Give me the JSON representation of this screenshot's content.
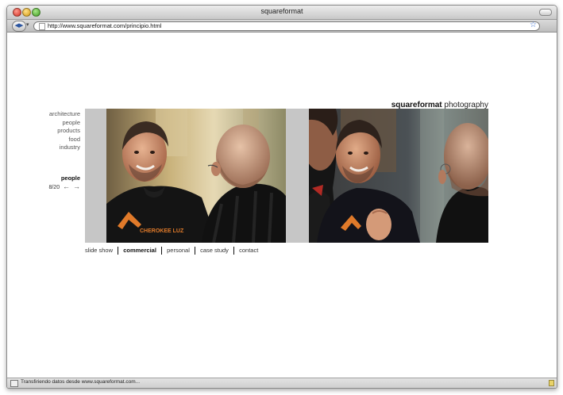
{
  "window": {
    "title": "squareformat"
  },
  "toolbar": {
    "url": "http://www.squareformat.com/principio.html",
    "back_icon": "back-arrow-icon",
    "bookmark_icon": "star-icon"
  },
  "site": {
    "brand_bold": "squareformat",
    "brand_light": "photography",
    "categories": [
      {
        "label": "architecture"
      },
      {
        "label": "people"
      },
      {
        "label": "products"
      },
      {
        "label": "food"
      },
      {
        "label": "industry"
      }
    ],
    "section_title": "people",
    "pager": "8/20",
    "prev_icon": "arrow-left-icon",
    "next_icon": "arrow-right-icon",
    "footer_nav": [
      {
        "label": "slide show",
        "active": false
      },
      {
        "label": "commercial",
        "active": true
      },
      {
        "label": "personal",
        "active": false
      },
      {
        "label": "case study",
        "active": false
      },
      {
        "label": "contact",
        "active": false
      }
    ],
    "photo1_shirt_text": "CHEROKEE LUZ",
    "colors": {
      "gallery_bg": "#c6c6c6",
      "shirt": "#161616",
      "logo_orange": "#e07a2a"
    }
  },
  "status": {
    "text": "Transfiriendo datos desde www.squareformat.com..."
  }
}
